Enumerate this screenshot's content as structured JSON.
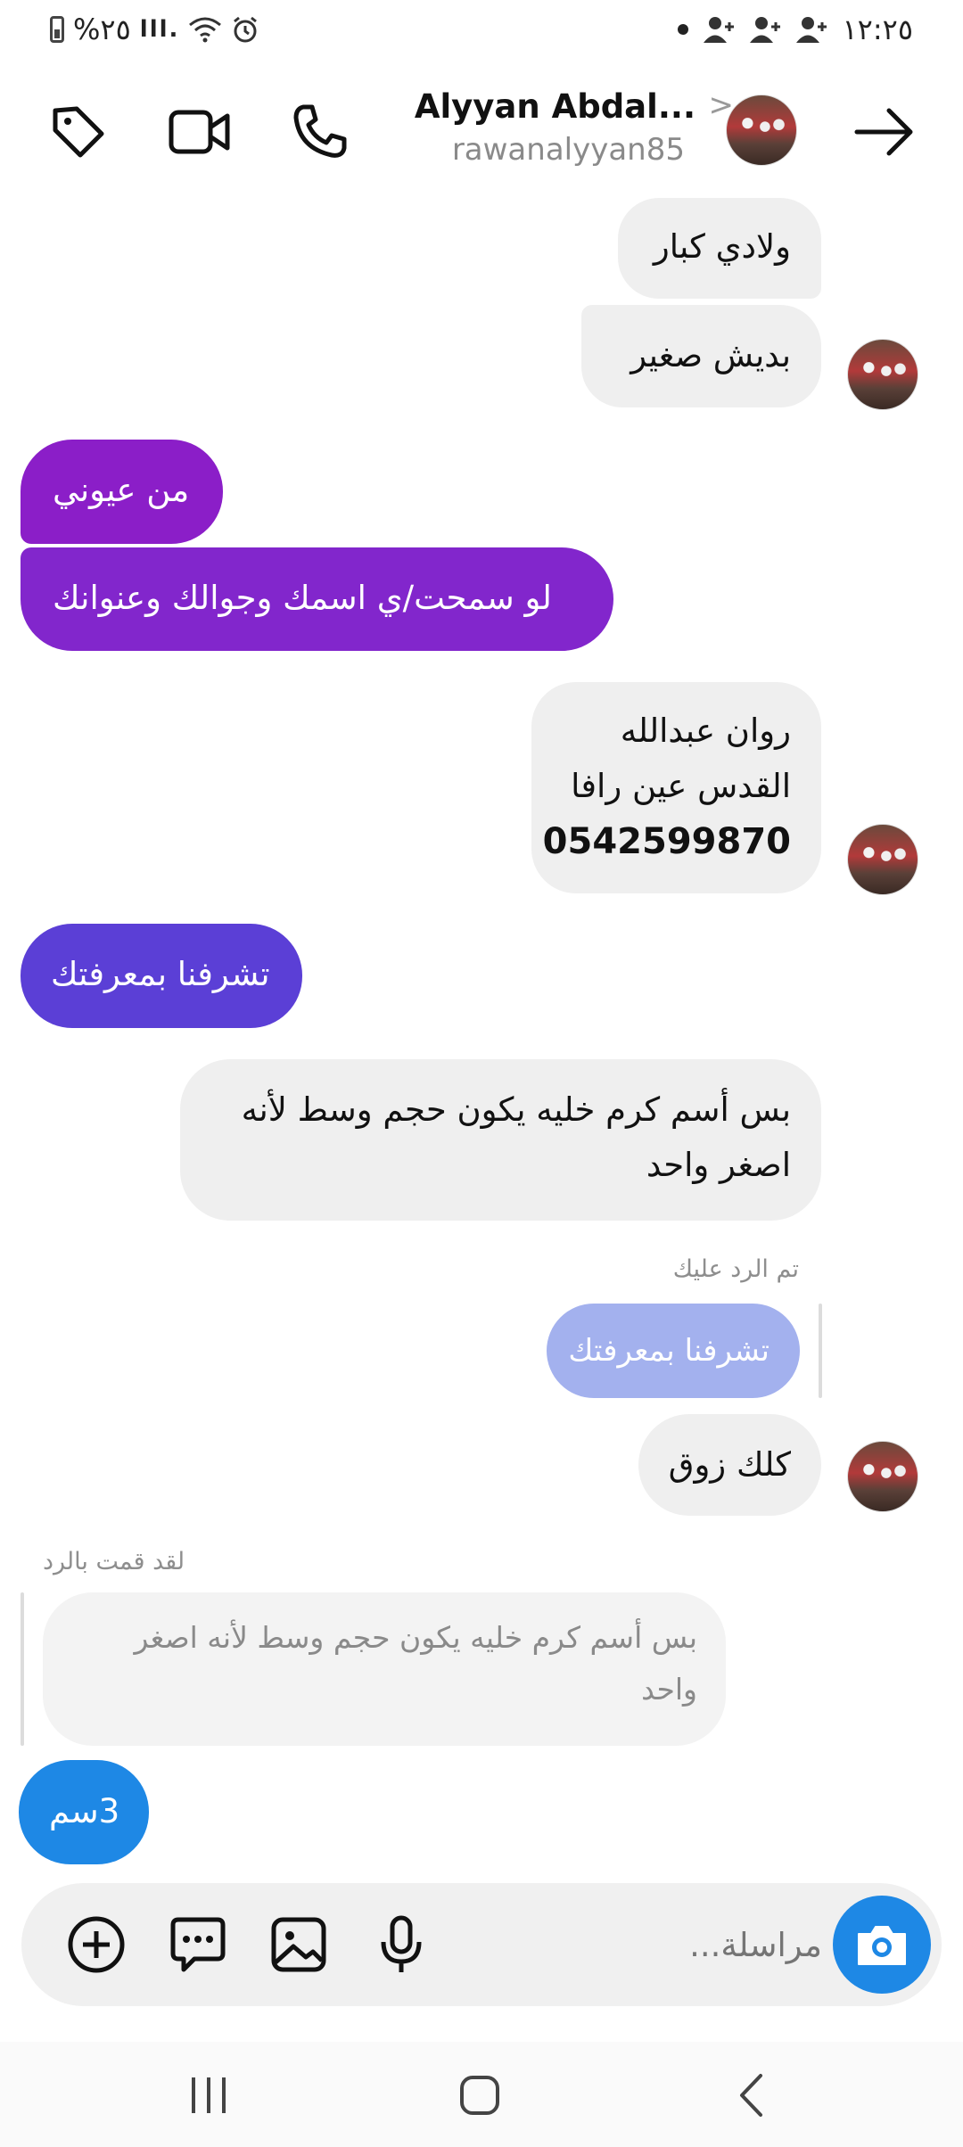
{
  "status_bar": {
    "time": "١٢:٢٥",
    "battery": "%٢٥",
    "signal": "lll."
  },
  "header": {
    "contact_name": "Alyyan Abdal...",
    "username": "rawanalyyan85"
  },
  "messages": [
    {
      "text": "ولادي كبار"
    },
    {
      "text": "بديش  صغير"
    },
    {
      "text": "من عيوني"
    },
    {
      "text": "لو سمحت/ي اسمك  وجوالك وعنوانك"
    },
    {
      "line1": "روان عبدالله",
      "line2": "القدس عين رافا",
      "line3": "0542599870"
    },
    {
      "text": "تشرفنا بمعرفتك"
    },
    {
      "line1": "بس أسم كرم خليه يكون حجم وسط لأنه",
      "line2": "اصغر واحد"
    },
    {
      "label": "تم الرد عليك",
      "quoted": "تشرفنا بمعرفتك"
    },
    {
      "text": "كلك زوق"
    },
    {
      "label": "لقد قمت بالرد",
      "quoted_line1": "بس أسم كرم خليه يكون حجم وسط لأنه اصغر",
      "quoted_line2": "واحد"
    },
    {
      "text": "3سم"
    }
  ],
  "composer": {
    "placeholder": "مراسلة..."
  },
  "colors": {
    "incoming_bg": "#efefef",
    "outgoing_purple": "#8b1ec8",
    "outgoing_violet": "#5b3fd6",
    "outgoing_blue": "#1e88e5",
    "quoted_bg": "#a3b1ee",
    "camera_button": "#1e88e5"
  },
  "icons": {
    "header": [
      "back-arrow-icon",
      "phone-icon",
      "video-call-icon",
      "tag-icon"
    ],
    "composer": [
      "camera-icon",
      "microphone-icon",
      "gallery-icon",
      "sticker-icon",
      "add-icon"
    ],
    "navigation": [
      "recent-apps-icon",
      "home-icon",
      "back-icon"
    ]
  }
}
